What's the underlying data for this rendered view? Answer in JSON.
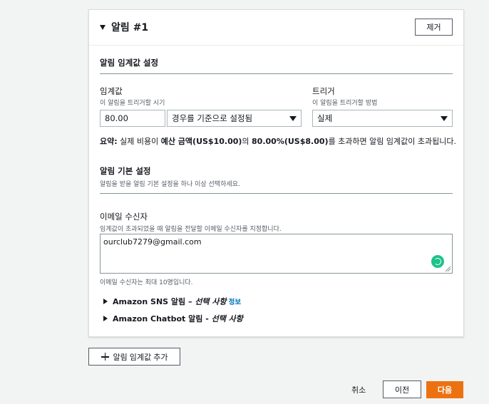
{
  "alarm": {
    "title": "알림 #1",
    "remove_label": "제거"
  },
  "threshold_settings": {
    "title": "알림 임계값 설정",
    "threshold": {
      "label": "임계값",
      "description": "이 알림을 트리거할 시기",
      "value": "80.00",
      "mode_selected": "경우를 기준으로 설정됨"
    },
    "trigger": {
      "label": "트리거",
      "description": "이 알림을 트리거할 방법",
      "selected": "실제"
    },
    "summary": {
      "prefix": "요약:",
      "text1": " 실제 비용이 ",
      "bold1": "예산 금액(US$10.00)",
      "text2": "의 ",
      "bold2": "80.00%(US$8.00)",
      "text3": "를 초과하면 알림 임계값이 초과됩니다."
    }
  },
  "basic_settings": {
    "title": "알림 기본 설정",
    "description": "알림을 받을 알림 기본 설정을 하나 이상 선택하세요."
  },
  "email": {
    "label": "이메일 수신자",
    "description": "임계값이 초과되었을 때 알림을 전달할 이메일 수신자를 지정합니다.",
    "value": "ourclub7279@gmail.com",
    "hint": "이메일 수신자는 최대 10명입니다."
  },
  "expanders": {
    "sns": {
      "bold": "Amazon SNS 알림 – ",
      "italic": "선택 사항",
      "info": "정보"
    },
    "chatbot": {
      "bold": "Amazon Chatbot 알림 - ",
      "italic": "선택 사항"
    }
  },
  "add_threshold_label": "알림 임계값 추가",
  "footer": {
    "cancel": "취소",
    "previous": "이전",
    "next": "다음"
  },
  "colors": {
    "primary": "#ec7211",
    "link": "#0073bb",
    "spinner": "#1ec28b"
  },
  "icons": [
    "caret-down-icon",
    "caret-right-icon",
    "plus-icon",
    "loading-spinner-icon",
    "resize-handle-icon"
  ]
}
